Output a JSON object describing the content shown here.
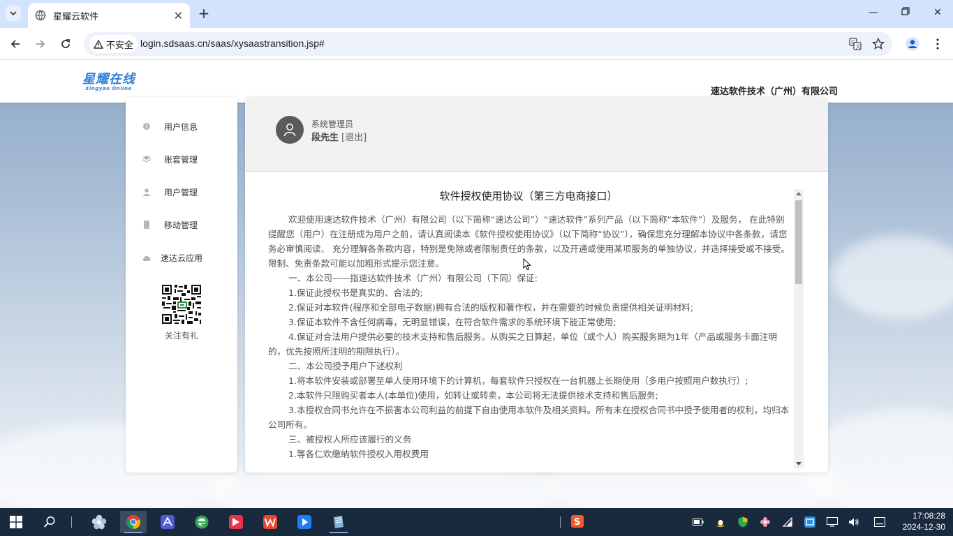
{
  "browser": {
    "tab_title": "星耀云软件",
    "security_label": "不安全",
    "url": "login.sdsaas.cn/saas/xysaastransition.jsp#"
  },
  "header": {
    "logo_cn": "星耀在线",
    "logo_en": "Xingyao Online",
    "company": "速达软件技术（广州）有限公司"
  },
  "sidebar": {
    "items": [
      {
        "label": "用户信息",
        "icon": "info-icon"
      },
      {
        "label": "账套管理",
        "icon": "layers-icon"
      },
      {
        "label": "用户管理",
        "icon": "user-icon"
      },
      {
        "label": "移动管理",
        "icon": "mobile-icon"
      },
      {
        "label": "速达云应用",
        "icon": "cloud-icon"
      }
    ],
    "qr_label": "关注有礼"
  },
  "user": {
    "role": "系统管理员",
    "name": "段先生",
    "logout": "[退出]"
  },
  "agreement": {
    "title": "软件授权使用协议（第三方电商接口）",
    "paragraphs": [
      "欢迎使用速达软件技术（广州）有限公司（以下简称“速达公司”）“速达软件”系列产品（以下简称“本软件”）及服务， 在此特别提醒您（用户）在注册成为用户之前，请认真阅读本《软件授权使用协议》（以下简称“协议”），确保您充分理解本协议中各条款，请您务必审慎阅读、 充分理解各条款内容，特别是免除或者限制责任的条款，以及开通或使用某项服务的单独协议，并选择接受或不接受。限制、免责条款可能以加粗形式提示您注意。",
      "一、本公司——指速达软件技术（广州）有限公司（下同）保证:",
      "1.保证此授权书是真实的、合法的;",
      "2.保证对本软件(程序和全部电子数据)拥有合法的版权和著作权，并在需要的时候负责提供相关证明材料;",
      "3.保证本软件不含任何病毒，无明显错误，在符合软件需求的系统环境下能正常使用;",
      "4.保证对合法用户提供必要的技术支持和售后服务。从购买之日算起，单位（或个人）购买服务期为1年（产品或服务卡面注明的，优先按照所注明的期限执行）。",
      "二、本公司授予用户下述权利",
      "1.将本软件安装或部署至单人使用环境下的计算机，每套软件只授权在一台机器上长期使用（多用户按照用户数执行）;",
      "2.本软件只限购买者本人(本单位)使用，如转让或转卖，本公司将无法提供技术支持和售后服务;",
      "3.本授权合同书允许在不损害本公司利益的前提下自由使用本软件及相关资料。所有未在授权合同书中授予使用者的权利，均归本公司所有。",
      "三、被授权人所应该履行的义务",
      "1.等各仁欢缴纳软件授权入用权费用"
    ]
  },
  "taskbar": {
    "time": "17:08:28",
    "date": "2024-12-30"
  }
}
